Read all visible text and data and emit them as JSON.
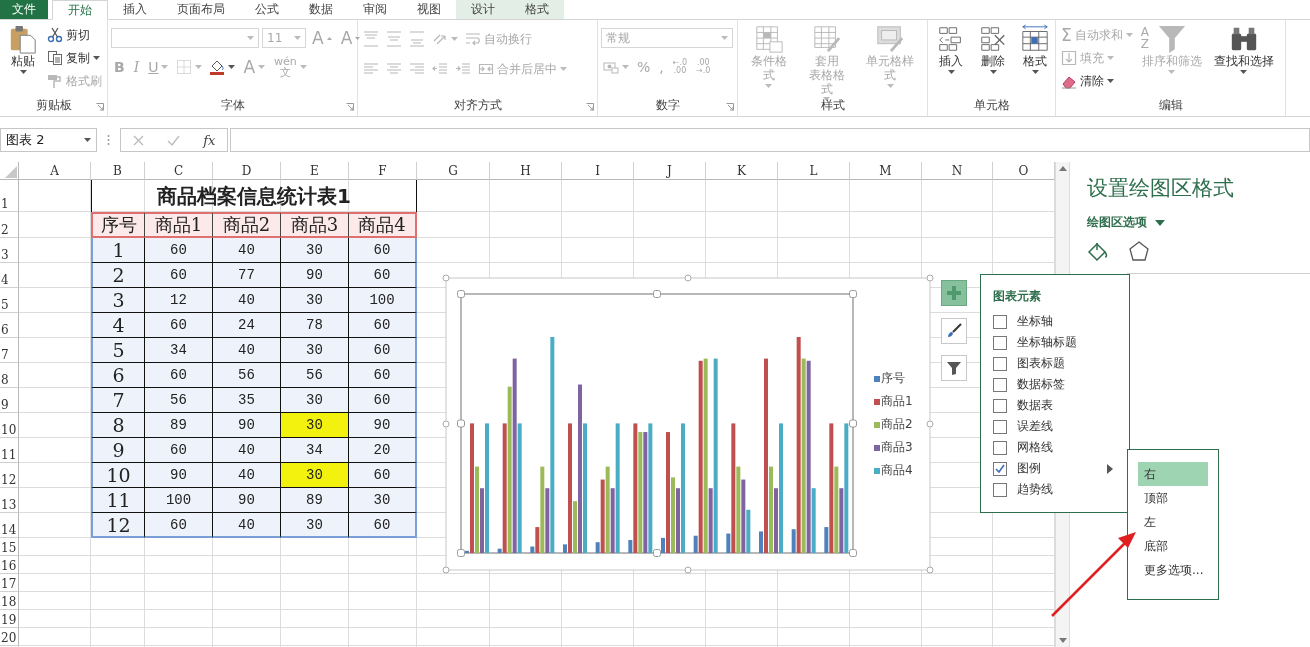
{
  "ribbon_tabs": [
    {
      "label": "文件",
      "kind": "file",
      "selected": false
    },
    {
      "label": "开始",
      "kind": "tab",
      "selected": true
    },
    {
      "label": "插入",
      "kind": "tab",
      "selected": false
    },
    {
      "label": "页面布局",
      "kind": "tab",
      "selected": false
    },
    {
      "label": "公式",
      "kind": "tab",
      "selected": false
    },
    {
      "label": "数据",
      "kind": "tab",
      "selected": false
    },
    {
      "label": "审阅",
      "kind": "tab",
      "selected": false
    },
    {
      "label": "视图",
      "kind": "tab",
      "selected": false
    },
    {
      "label": "设计",
      "kind": "context",
      "selected": false
    },
    {
      "label": "格式",
      "kind": "context",
      "selected": false
    }
  ],
  "ribbon": {
    "groups": [
      {
        "kind": "clipboard",
        "label": "剪贴板",
        "launcher": true,
        "items": [
          {
            "kind": "paste",
            "label": "粘贴",
            "caret": true,
            "disabled": false
          },
          {
            "kind": "cut",
            "label": "剪切",
            "disabled": false
          },
          {
            "kind": "copy",
            "label": "复制",
            "caret": true,
            "disabled": false
          },
          {
            "kind": "painter",
            "label": "格式刷",
            "disabled": true
          }
        ]
      },
      {
        "kind": "font",
        "label": "字体",
        "launcher": true,
        "items": [
          {
            "kind": "font_name",
            "caret": true,
            "disabled": true
          },
          {
            "kind": "font_size",
            "value": "11",
            "caret": true,
            "disabled": true
          },
          {
            "kind": "grow",
            "label": "A",
            "disabled": true
          },
          {
            "kind": "shrink",
            "label": "A",
            "disabled": true
          },
          {
            "kind": "bold",
            "label": "B",
            "disabled": true
          },
          {
            "kind": "italic",
            "label": "I",
            "disabled": true
          },
          {
            "kind": "underline",
            "label": "U",
            "caret": true,
            "disabled": true
          },
          {
            "kind": "border",
            "caret": true,
            "disabled": true
          },
          {
            "kind": "fill",
            "caret": true,
            "disabled": false
          },
          {
            "kind": "font_color",
            "label": "A",
            "caret": true,
            "disabled": true
          },
          {
            "kind": "phonetic",
            "label": "wén\n文",
            "caret": true,
            "disabled": true
          }
        ]
      },
      {
        "kind": "alignment",
        "label": "对齐方式",
        "launcher": true,
        "items": [
          {
            "kind": "align_top",
            "disabled": true
          },
          {
            "kind": "align_middle",
            "disabled": true
          },
          {
            "kind": "align_bottom",
            "disabled": true
          },
          {
            "kind": "orientation",
            "caret": true,
            "disabled": true
          },
          {
            "kind": "wrap",
            "label": "自动换行",
            "disabled": true
          },
          {
            "kind": "align_left",
            "disabled": true
          },
          {
            "kind": "align_center",
            "disabled": true
          },
          {
            "kind": "align_right",
            "disabled": true
          },
          {
            "kind": "indent_dec",
            "disabled": true
          },
          {
            "kind": "indent_inc",
            "disabled": true
          },
          {
            "kind": "merge",
            "label": "合并后居中",
            "caret": true,
            "disabled": true
          }
        ]
      },
      {
        "kind": "number",
        "label": "数字",
        "launcher": true,
        "items": [
          {
            "kind": "number_format",
            "value": "常规",
            "caret": true,
            "disabled": true
          },
          {
            "kind": "accounting",
            "caret": true,
            "disabled": true
          },
          {
            "kind": "percent",
            "label": "%",
            "disabled": true
          },
          {
            "kind": "comma",
            "label": ",",
            "disabled": true
          },
          {
            "kind": "decimal_up",
            "label": "←.0\n.00",
            "disabled": true
          },
          {
            "kind": "decimal_down",
            "label": ".00\n→.0",
            "disabled": true
          }
        ]
      },
      {
        "kind": "styles",
        "label": "样式",
        "items": [
          {
            "kind": "conditional",
            "label": "条件格式",
            "caret": true,
            "disabled": true
          },
          {
            "kind": "table_format",
            "label": [
              "套用",
              "表格格式"
            ],
            "caret": true,
            "disabled": true
          },
          {
            "kind": "cell_styles",
            "label": "单元格样式",
            "caret": true,
            "disabled": true
          }
        ]
      },
      {
        "kind": "cells",
        "label": "单元格",
        "items": [
          {
            "kind": "insert_cells",
            "label": "插入",
            "caret": true,
            "disabled": false
          },
          {
            "kind": "delete_cells",
            "label": "删除",
            "caret": true,
            "disabled": false
          },
          {
            "kind": "format_cells",
            "label": "格式",
            "caret": true,
            "disabled": false
          }
        ]
      },
      {
        "kind": "editing",
        "label": "编辑",
        "items": [
          {
            "kind": "autosum",
            "icon_char": "Σ",
            "label": "自动求和",
            "caret": true,
            "disabled": true
          },
          {
            "kind": "fill_down",
            "label": "填充",
            "caret": true,
            "disabled": true
          },
          {
            "kind": "clear",
            "label": "清除",
            "caret": true,
            "disabled": false
          },
          {
            "kind": "sort",
            "icon_char": "A\nZ",
            "label": "排序和筛选",
            "caret": true,
            "disabled": true
          },
          {
            "kind": "find",
            "label": "查找和选择",
            "caret": true,
            "disabled": false
          }
        ]
      }
    ]
  },
  "formula_bar": {
    "name_box": "图表 2",
    "function_label": "fx"
  },
  "sheet": {
    "columns": [
      "A",
      "B",
      "C",
      "D",
      "E",
      "F",
      "G",
      "H",
      "I",
      "J",
      "K",
      "L",
      "M",
      "N",
      "O"
    ],
    "rows": [
      "1",
      "2",
      "3",
      "4",
      "5",
      "6",
      "7",
      "8",
      "9",
      "10",
      "11",
      "12",
      "13",
      "14",
      "15",
      "16",
      "17",
      "18",
      "19",
      "20"
    ]
  },
  "table": {
    "title": "商品档案信息统计表1",
    "columns": [
      "序号",
      "商品1",
      "商品2",
      "商品3",
      "商品4"
    ],
    "rows": [
      {
        "cells": [
          "1",
          "60",
          "40",
          "30",
          "60"
        ],
        "highlighted": [
          false,
          false,
          false,
          false,
          false
        ]
      },
      {
        "cells": [
          "2",
          "60",
          "77",
          "90",
          "60"
        ],
        "highlighted": [
          false,
          false,
          false,
          false,
          false
        ]
      },
      {
        "cells": [
          "3",
          "12",
          "40",
          "30",
          "100"
        ],
        "highlighted": [
          false,
          false,
          false,
          false,
          false
        ]
      },
      {
        "cells": [
          "4",
          "60",
          "24",
          "78",
          "60"
        ],
        "highlighted": [
          false,
          false,
          false,
          false,
          false
        ]
      },
      {
        "cells": [
          "5",
          "34",
          "40",
          "30",
          "60"
        ],
        "highlighted": [
          false,
          false,
          false,
          false,
          false
        ]
      },
      {
        "cells": [
          "6",
          "60",
          "56",
          "56",
          "60"
        ],
        "highlighted": [
          false,
          false,
          false,
          false,
          false
        ]
      },
      {
        "cells": [
          "7",
          "56",
          "35",
          "30",
          "60"
        ],
        "highlighted": [
          false,
          false,
          false,
          false,
          false
        ]
      },
      {
        "cells": [
          "8",
          "89",
          "90",
          "30",
          "90"
        ],
        "highlighted": [
          false,
          false,
          false,
          true,
          false
        ]
      },
      {
        "cells": [
          "9",
          "60",
          "40",
          "34",
          "20"
        ],
        "highlighted": [
          false,
          false,
          false,
          false,
          false
        ]
      },
      {
        "cells": [
          "10",
          "90",
          "40",
          "30",
          "60"
        ],
        "highlighted": [
          false,
          false,
          false,
          true,
          false
        ]
      },
      {
        "cells": [
          "11",
          "100",
          "90",
          "89",
          "30"
        ],
        "highlighted": [
          false,
          false,
          false,
          false,
          false
        ]
      },
      {
        "cells": [
          "12",
          "60",
          "40",
          "30",
          "60"
        ],
        "highlighted": [
          false,
          false,
          false,
          false,
          false
        ]
      }
    ]
  },
  "chart": {
    "legend": [
      {
        "label": "序号",
        "color": "#4f81bd"
      },
      {
        "label": "商品1",
        "color": "#c0504d"
      },
      {
        "label": "商品2",
        "color": "#9bbb59"
      },
      {
        "label": "商品3",
        "color": "#8064a2"
      },
      {
        "label": "商品4",
        "color": "#4bacc6"
      }
    ]
  },
  "chart_buttons": [
    {
      "kind": "elements",
      "selected": true
    },
    {
      "kind": "styles",
      "selected": false
    },
    {
      "kind": "filter",
      "selected": false
    }
  ],
  "chart_elements": {
    "title": "图表元素",
    "items": [
      {
        "label": "坐标轴",
        "checked": false
      },
      {
        "label": "坐标轴标题",
        "checked": false
      },
      {
        "label": "图表标题",
        "checked": false
      },
      {
        "label": "数据标签",
        "checked": false
      },
      {
        "label": "数据表",
        "checked": false
      },
      {
        "label": "误差线",
        "checked": false
      },
      {
        "label": "网格线",
        "checked": false
      },
      {
        "label": "图例",
        "checked": true,
        "submenu": true
      },
      {
        "label": "趋势线",
        "checked": false
      }
    ]
  },
  "legend_position_menu": {
    "items": [
      {
        "label": "右",
        "selected": true
      },
      {
        "label": "顶部",
        "selected": false
      },
      {
        "label": "左",
        "selected": false
      },
      {
        "label": "底部",
        "selected": false
      },
      {
        "label": "更多选项...",
        "selected": false
      }
    ]
  },
  "format_pane": {
    "title": "设置绘图区格式",
    "section": "绘图区选项"
  }
}
